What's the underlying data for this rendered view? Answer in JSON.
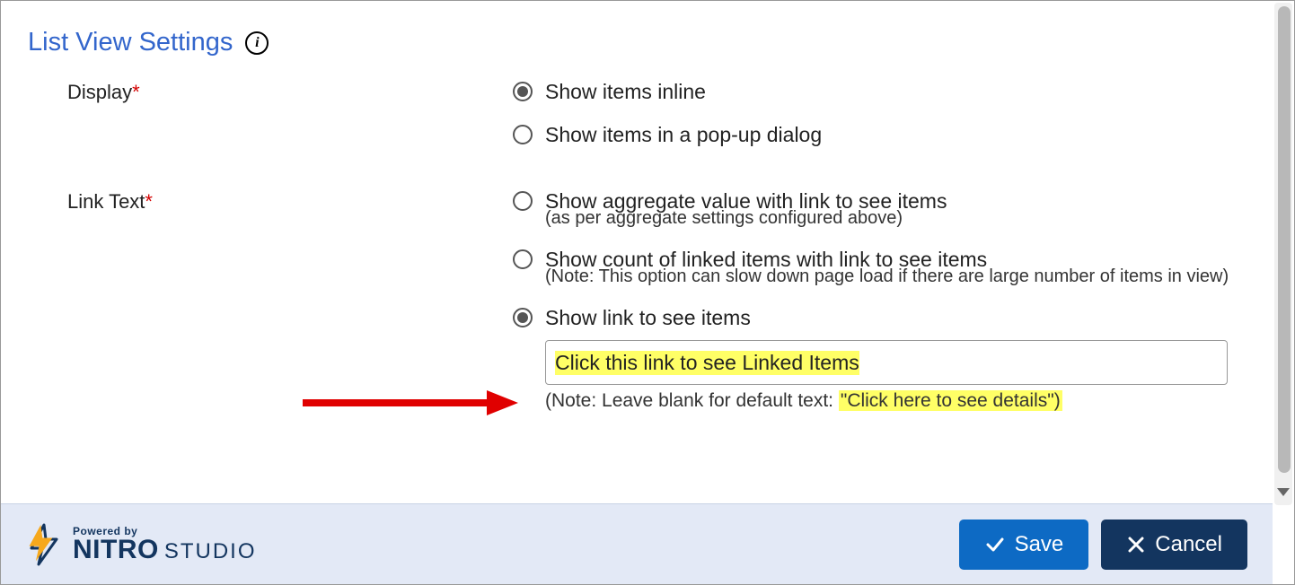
{
  "section": {
    "title": "List View Settings"
  },
  "labels": {
    "display": "Display",
    "linkText": "Link Text"
  },
  "display": {
    "inline": "Show items inline",
    "popup": "Show items in a pop-up dialog"
  },
  "linkText": {
    "aggregate": "Show aggregate value with link to see items",
    "aggregate_sub": "(as per aggregate settings configured above)",
    "count": "Show count of linked items with link to see items",
    "count_sub": "(Note: This option can slow down page load if there are large number of items in view)",
    "showlink": "Show link to see items",
    "input_value": "Click this link to see Linked Items",
    "note_prefix": "(Note: Leave blank for default text: ",
    "note_highlight": "\"Click here to see details\")"
  },
  "footer": {
    "powered": "Powered by",
    "logo_nitro": "NITRO",
    "logo_studio": "STUDIO",
    "save": "Save",
    "cancel": "Cancel"
  }
}
